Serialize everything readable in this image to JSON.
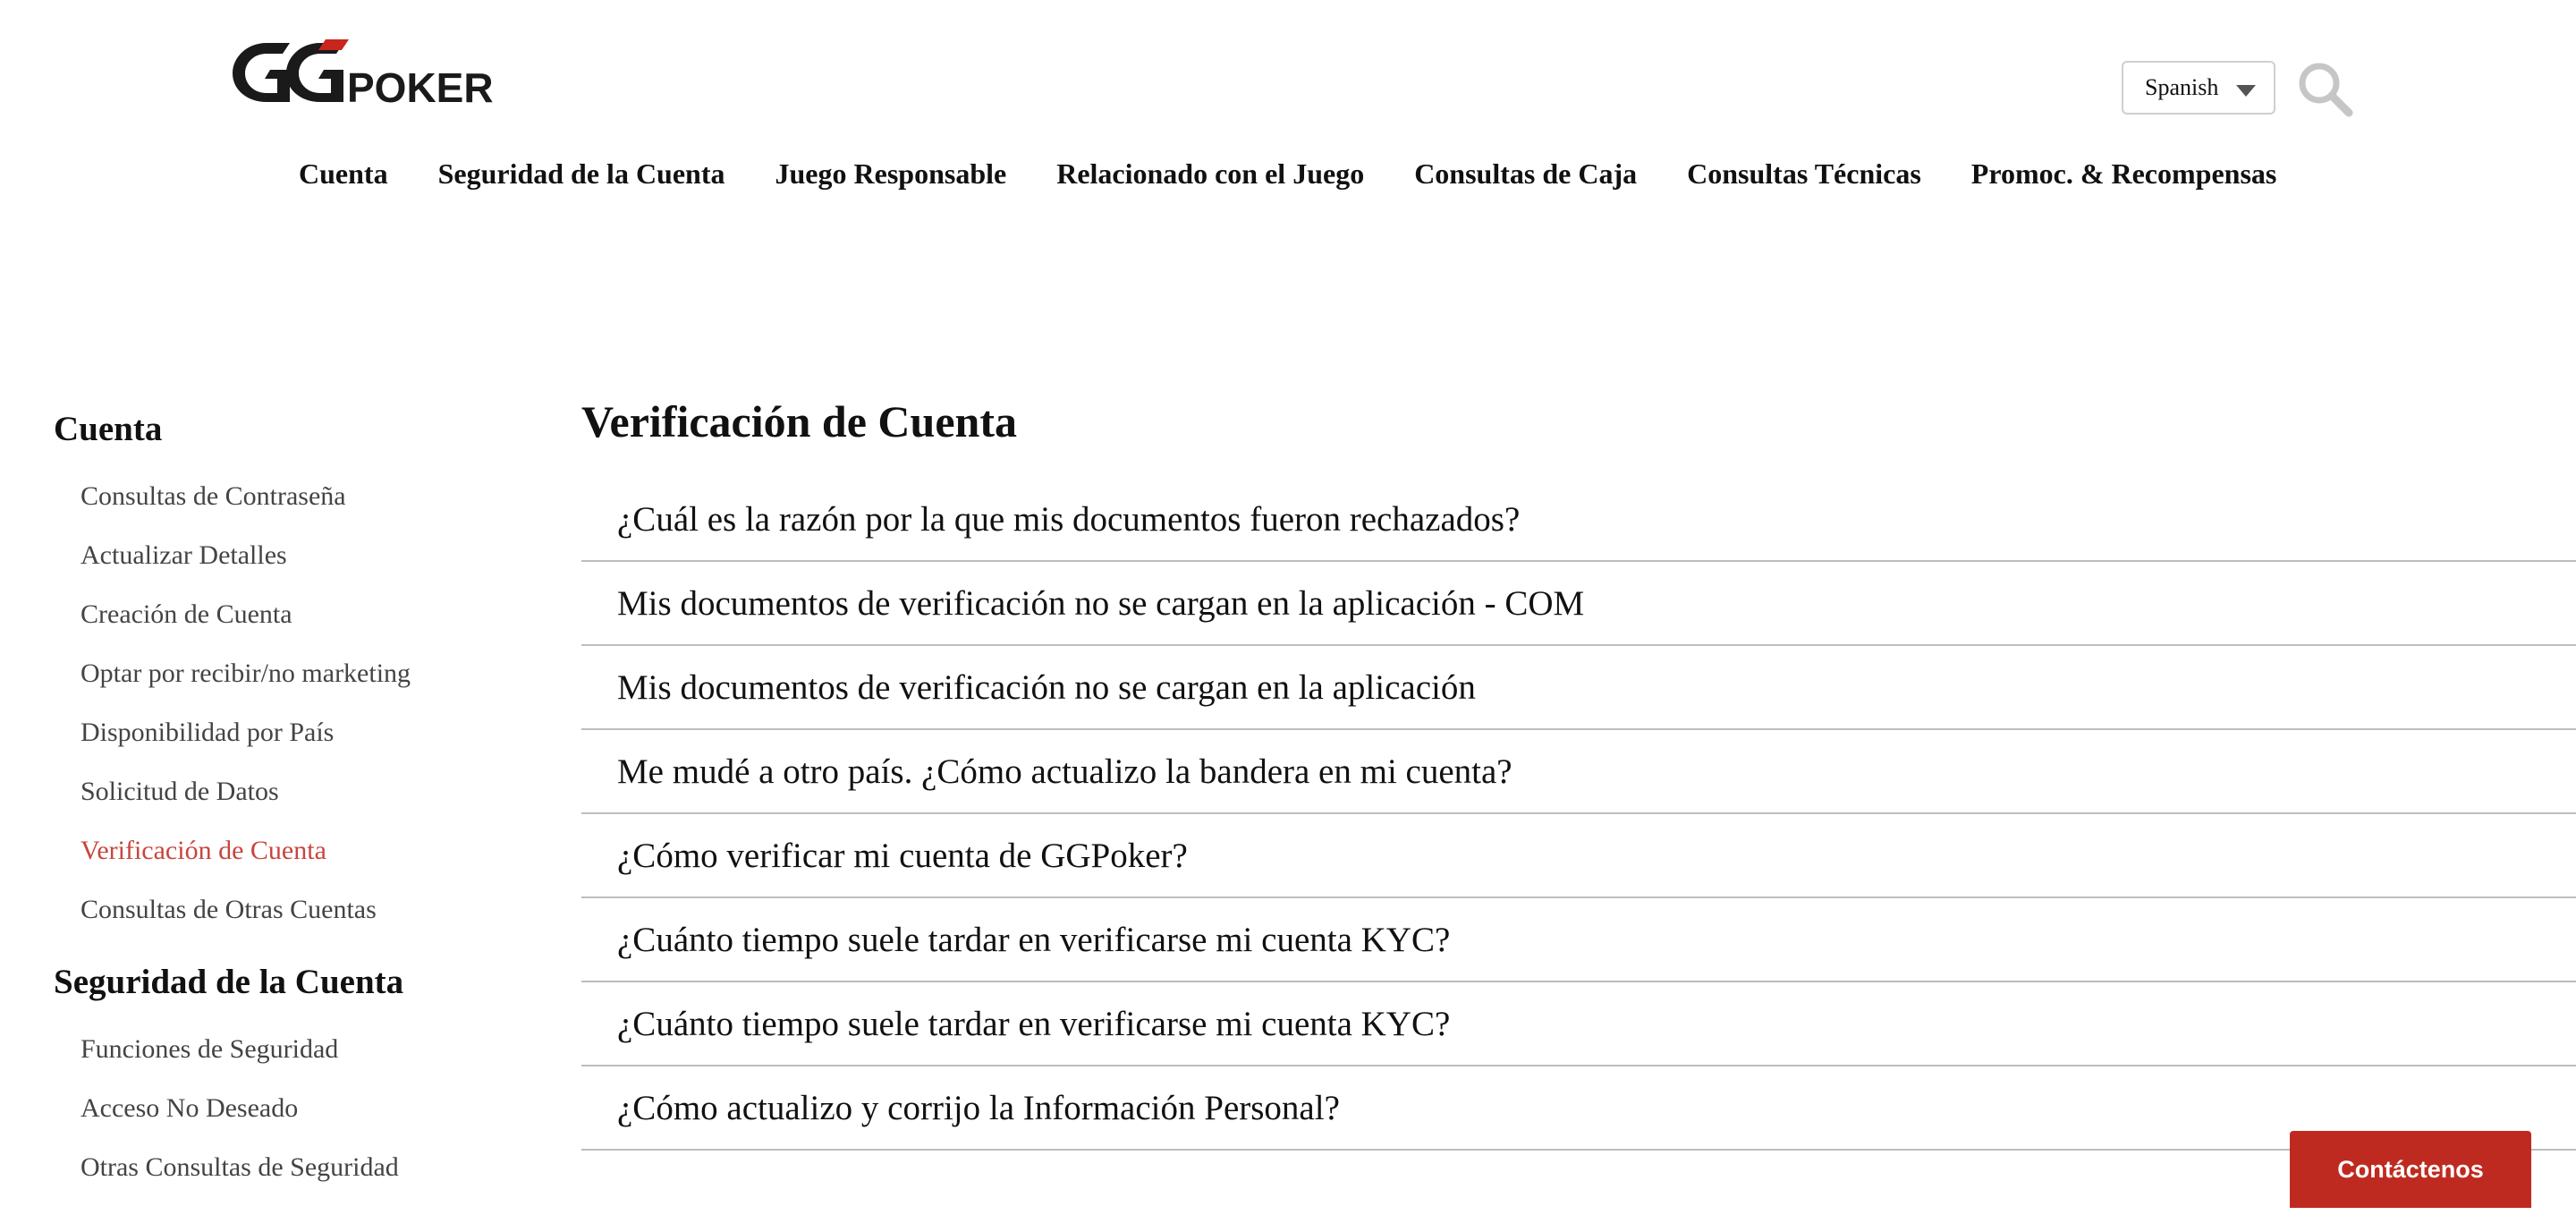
{
  "header": {
    "logo_text": "GGPOKER",
    "language": "Spanish",
    "icons": {
      "search": "search-icon",
      "dropdown": "caret-down-icon"
    }
  },
  "nav": [
    {
      "label": "Cuenta"
    },
    {
      "label": "Seguridad de la Cuenta"
    },
    {
      "label": "Juego Responsable"
    },
    {
      "label": "Relacionado con el Juego"
    },
    {
      "label": "Consultas de Caja"
    },
    {
      "label": "Consultas Técnicas"
    },
    {
      "label": "Promoc. & Recompensas"
    }
  ],
  "sidebar": {
    "sections": [
      {
        "title": "Cuenta",
        "items": [
          {
            "label": "Consultas de Contraseña"
          },
          {
            "label": "Actualizar Detalles"
          },
          {
            "label": "Creación de Cuenta"
          },
          {
            "label": "Optar por recibir/no marketing"
          },
          {
            "label": "Disponibilidad por País"
          },
          {
            "label": "Solicitud de Datos"
          },
          {
            "label": "Verificación de Cuenta"
          },
          {
            "label": "Consultas de Otras Cuentas"
          }
        ]
      },
      {
        "title": "Seguridad de la Cuenta",
        "items": [
          {
            "label": "Funciones de Seguridad"
          },
          {
            "label": "Acceso No Deseado"
          },
          {
            "label": "Otras Consultas de Seguridad"
          }
        ]
      }
    ],
    "active_item": "Verificación de Cuenta"
  },
  "main": {
    "title": "Verificación de Cuenta",
    "articles": [
      {
        "title": "¿Cuál es la razón por la que mis documentos fueron rechazados?"
      },
      {
        "title": "Mis documentos de verificación no se cargan en la aplicación - COM"
      },
      {
        "title": "Mis documentos de verificación no se cargan en la aplicación"
      },
      {
        "title": "Me mudé a otro país. ¿Cómo actualizo la bandera en mi cuenta?"
      },
      {
        "title": "¿Cómo verificar mi cuenta de GGPoker?"
      },
      {
        "title": "¿Cuánto tiempo suele tardar en verificarse mi cuenta KYC?"
      },
      {
        "title": "¿Cuánto tiempo suele tardar en verificarse mi cuenta KYC?"
      },
      {
        "title": "¿Cómo actualizo y corrijo la Información Personal?"
      }
    ]
  },
  "contact": {
    "label": "Contáctenos"
  },
  "colors": {
    "brand_red": "#bf2a20",
    "active_link": "#c8453d",
    "divider": "#bdbdbd"
  }
}
